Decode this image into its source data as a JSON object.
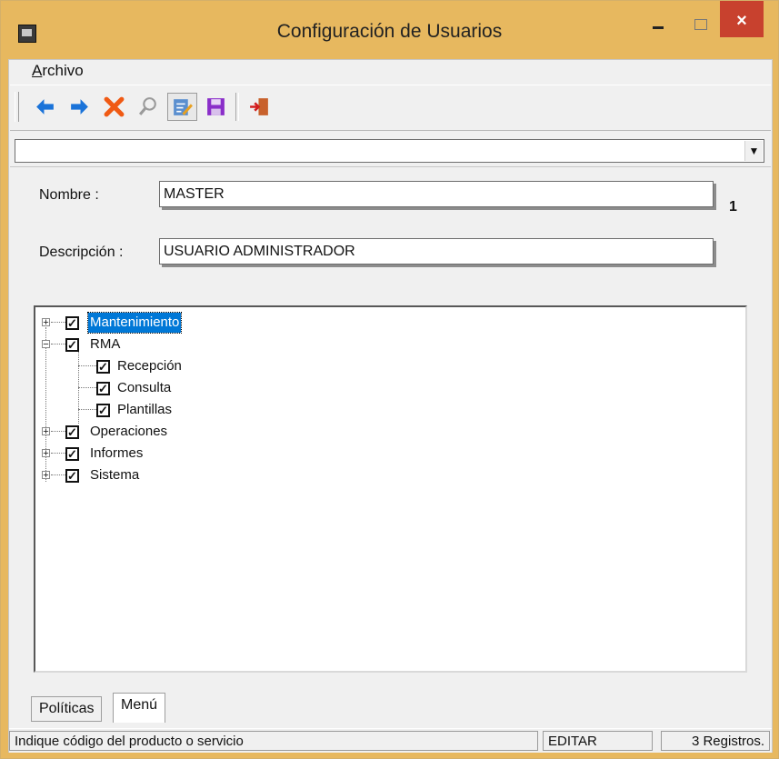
{
  "window": {
    "title": "Configuración de Usuarios",
    "close_symbol": "×"
  },
  "menu": {
    "archivo_first": "A",
    "archivo_rest": "rchivo"
  },
  "toolbar": {
    "buttons": [
      "arrow-left-icon",
      "arrow-right-icon",
      "delete-x-icon",
      "search-icon",
      "edit-document-icon",
      "save-icon",
      "exit-door-icon"
    ]
  },
  "combo": {
    "value": ""
  },
  "form": {
    "nombre_label": "Nombre :",
    "nombre_value": "MASTER",
    "record_number": "1",
    "descripcion_label": "Descripción :",
    "descripcion_value": "USUARIO ADMINISTRADOR"
  },
  "tree": {
    "nodes": [
      {
        "label": "Mantenimiento",
        "checked": true,
        "expander": "+",
        "selected": true
      },
      {
        "label": "RMA",
        "checked": true,
        "expander": "−"
      },
      {
        "label": "Recepción",
        "checked": true
      },
      {
        "label": "Consulta",
        "checked": true
      },
      {
        "label": "Plantillas",
        "checked": true
      },
      {
        "label": "Operaciones",
        "checked": true,
        "expander": "+"
      },
      {
        "label": "Informes",
        "checked": true,
        "expander": "+"
      },
      {
        "label": "Sistema",
        "checked": true,
        "expander": "+"
      }
    ]
  },
  "tabs": [
    {
      "label": "Políticas"
    },
    {
      "label": "Menú",
      "active": true
    }
  ],
  "status": {
    "message": "Indique código del producto o servicio",
    "mode": "EDITAR",
    "records": "3 Registros."
  }
}
